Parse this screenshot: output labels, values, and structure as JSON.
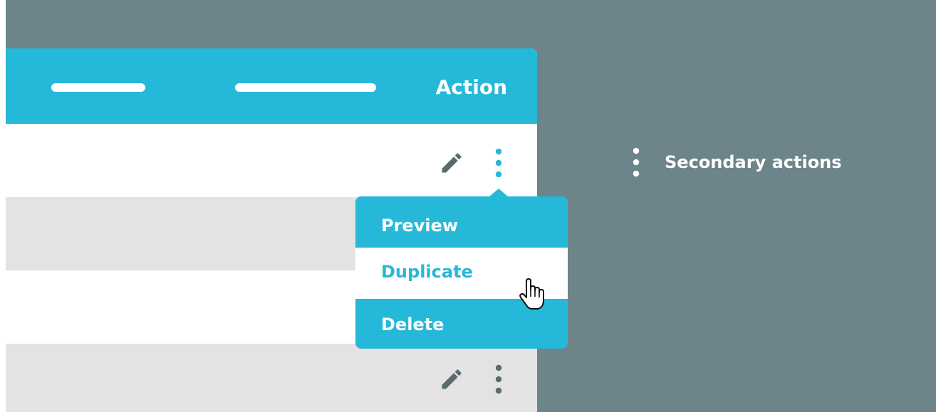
{
  "header": {
    "action_label": "Action"
  },
  "dropdown": {
    "items": [
      {
        "label": "Preview",
        "state": "default"
      },
      {
        "label": "Duplicate",
        "state": "hovered"
      },
      {
        "label": "Delete",
        "state": "default"
      }
    ]
  },
  "legend": {
    "label": "Secondary actions",
    "icon": "kebab-icon"
  },
  "icons": {
    "edit": "pencil-icon",
    "more": "kebab-icon",
    "pointer": "hand-cursor-icon"
  },
  "colors": {
    "accent": "#26b8d8",
    "background": "#6c848a",
    "row_alt": "#e3e3e3",
    "icon_gray": "#5a6b70"
  }
}
